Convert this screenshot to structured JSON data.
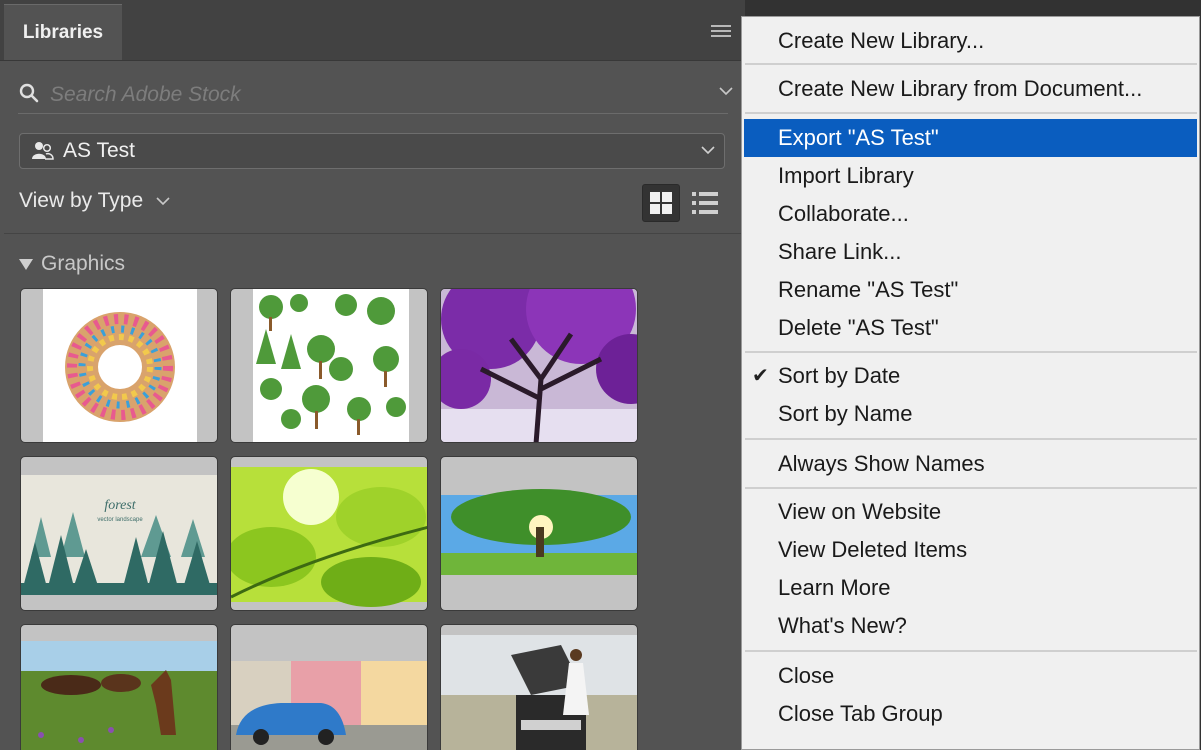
{
  "panel": {
    "tab_label": "Libraries",
    "search_placeholder": "Search Adobe Stock",
    "library_name": "AS Test",
    "view_by_label": "View by Type",
    "section_label": "Graphics"
  },
  "thumbnails": [
    {
      "name": "donut-thumb"
    },
    {
      "name": "trees-clipart-thumb"
    },
    {
      "name": "purple-tree-thumb"
    },
    {
      "name": "forest-landscape-thumb"
    },
    {
      "name": "green-leaves-thumb"
    },
    {
      "name": "green-tree-thumb"
    },
    {
      "name": "horses-thumb"
    },
    {
      "name": "blue-car-thumb"
    },
    {
      "name": "truck-girl-thumb"
    }
  ],
  "forest_thumb_text": {
    "title": "forest",
    "subtitle": "vector landscape"
  },
  "menu": {
    "items": [
      {
        "label": "Create New Library..."
      },
      {
        "label": "Create New Library from Document..."
      },
      {
        "label": "Export \"AS Test\"",
        "highlighted": true
      },
      {
        "label": "Import Library"
      },
      {
        "label": "Collaborate..."
      },
      {
        "label": "Share Link..."
      },
      {
        "label": "Rename \"AS Test\""
      },
      {
        "label": "Delete \"AS Test\""
      },
      {
        "label": "Sort by Date",
        "checked": true
      },
      {
        "label": "Sort by Name"
      },
      {
        "label": "Always Show Names"
      },
      {
        "label": "View on Website"
      },
      {
        "label": "View Deleted Items"
      },
      {
        "label": "Learn More"
      },
      {
        "label": "What's New?"
      },
      {
        "label": "Close"
      },
      {
        "label": "Close Tab Group"
      }
    ]
  },
  "colors": {
    "panel_bg": "#535353",
    "menu_bg": "#f0f0f0",
    "highlight": "#0a5dbf"
  }
}
